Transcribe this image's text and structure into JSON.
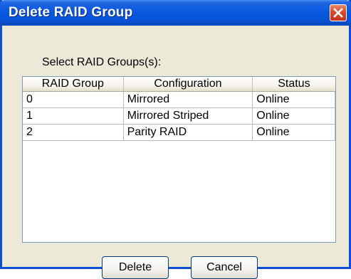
{
  "window": {
    "title": "Delete RAID Group"
  },
  "dialog": {
    "prompt": "Select RAID Groups(s):",
    "table": {
      "columns": [
        "RAID Group",
        "Configuration",
        "Status"
      ],
      "rows": [
        [
          "0",
          "Mirrored",
          "Online"
        ],
        [
          "1",
          "Mirrored Striped",
          "Online"
        ],
        [
          "2",
          "Parity RAID",
          "Online"
        ]
      ]
    },
    "buttons": {
      "delete_label": "Delete",
      "cancel_label": "Cancel"
    }
  },
  "icons": {
    "close": "close-icon"
  },
  "colors": {
    "titlebar": "#0852d6",
    "window_face": "#ece9d8",
    "close_button": "#d94a2a"
  }
}
